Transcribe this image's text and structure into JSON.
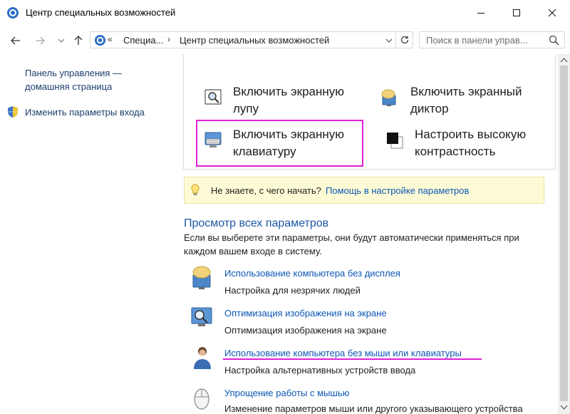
{
  "window": {
    "title": "Центр специальных возможностей",
    "minimize_label": "—",
    "maximize_label": "☐",
    "close_label": "✕"
  },
  "nav": {
    "back": "←",
    "forward": "→",
    "dropdown": "⌄",
    "up": "↑"
  },
  "address": {
    "overflow": "«",
    "crumbs": [
      "Специа...",
      "Центр специальных возможностей"
    ],
    "separator": "›",
    "dropdown": "⌄",
    "refresh": "↻"
  },
  "search": {
    "placeholder": "Поиск в панели управ..."
  },
  "sidebar": {
    "home_link_line1": "Панель управления —",
    "home_link_line2": "домашняя страница",
    "signin_link": "Изменить параметры входа"
  },
  "quick_actions": [
    {
      "line1": "Включить экранную",
      "line2": "лупу",
      "icon": "magnifier-icon"
    },
    {
      "line1": "Включить экранный",
      "line2": "диктор",
      "icon": "narrator-icon"
    },
    {
      "line1": "Включить экранную",
      "line2": "клавиатуру",
      "icon": "keyboard-icon"
    },
    {
      "line1": "Настроить высокую",
      "line2": "контрастность",
      "icon": "contrast-icon"
    }
  ],
  "tip": {
    "question": "Не знаете, с чего начать?",
    "link": "Помощь в настройке параметров"
  },
  "all_settings": {
    "title": "Просмотр всех параметров",
    "description": "Если вы выберете эти параметры, они будут автоматически применяться при каждом вашем входе в систему.",
    "options": [
      {
        "link": "Использование компьютера без дисплея",
        "desc": "Настройка для незрячих людей",
        "icon": "speech-bubble-icon"
      },
      {
        "link": "Оптимизация изображения на экране",
        "desc": "Оптимизация изображения на экране",
        "icon": "screen-magnify-icon"
      },
      {
        "link": "Использование компьютера без мыши или клавиатуры",
        "desc": "Настройка альтернативных устройств ввода",
        "icon": "person-icon"
      },
      {
        "link": "Упрощение работы с мышью",
        "desc": "Изменение параметров мыши или другого указывающего устройства",
        "icon": "mouse-icon"
      }
    ]
  },
  "colors": {
    "link": "#0b56b5",
    "highlight": "#e021d4",
    "tip_background": "#fdfbd5"
  }
}
